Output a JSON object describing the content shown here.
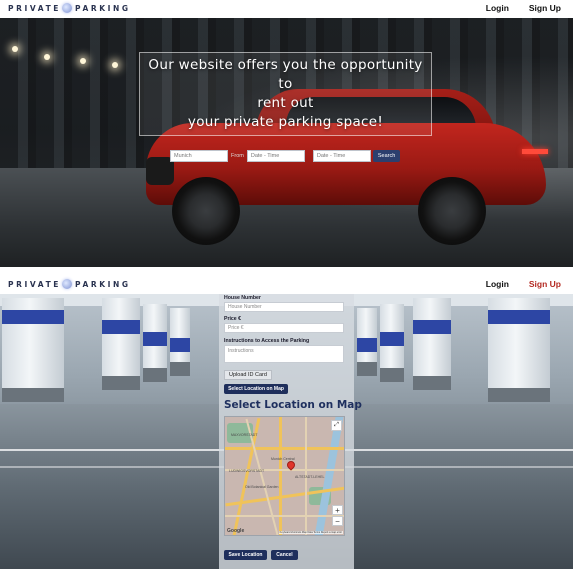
{
  "top_header": {
    "logo": {
      "left": "PRIVATE",
      "right": "PARKING"
    },
    "nav": {
      "login": "Login",
      "signup": "Sign Up"
    }
  },
  "hero": {
    "headline_line1": "Our website offers you the opportunity to",
    "headline_line2": "rent out",
    "headline_line3": "your private parking space!",
    "search": {
      "location_placeholder": "Munich",
      "from_label": "From",
      "from_placeholder": "Date - Time",
      "to_placeholder": "Date - Time",
      "search_label": "Search"
    }
  },
  "second_header": {
    "logo": {
      "left": "PRIVATE",
      "right": "PARKING"
    },
    "nav": {
      "login": "Login",
      "signup": "Sign Up"
    }
  },
  "form": {
    "house_number_label": "House Number",
    "house_number_placeholder": "House Number",
    "price_label": "Price €",
    "price_placeholder": "Price €",
    "instructions_label": "Instructions to Access the Parking",
    "instructions_placeholder": "Instructions",
    "upload_label": "Upload ID Card",
    "select_location_button": "Select Location on Map",
    "map_title": "Select Location on Map",
    "save_button": "Save Location",
    "cancel_button": "Cancel"
  },
  "map": {
    "labels": [
      "MAXVORSTADT",
      "Munich Central",
      "ALTSTADT-LEHEL",
      "LUDWIGSVORSTADT",
      "Old Botanical Garden"
    ],
    "zoom_in": "+",
    "zoom_out": "−",
    "fullscreen_icon": "⤢",
    "provider": "Google",
    "attribution": "Keyboard shortcuts  Map Data  Terms  Report a map error"
  },
  "colors": {
    "brand_navy": "#1f2f5c",
    "signup_red": "#b42a22",
    "map_title": "#1e2f5e"
  }
}
